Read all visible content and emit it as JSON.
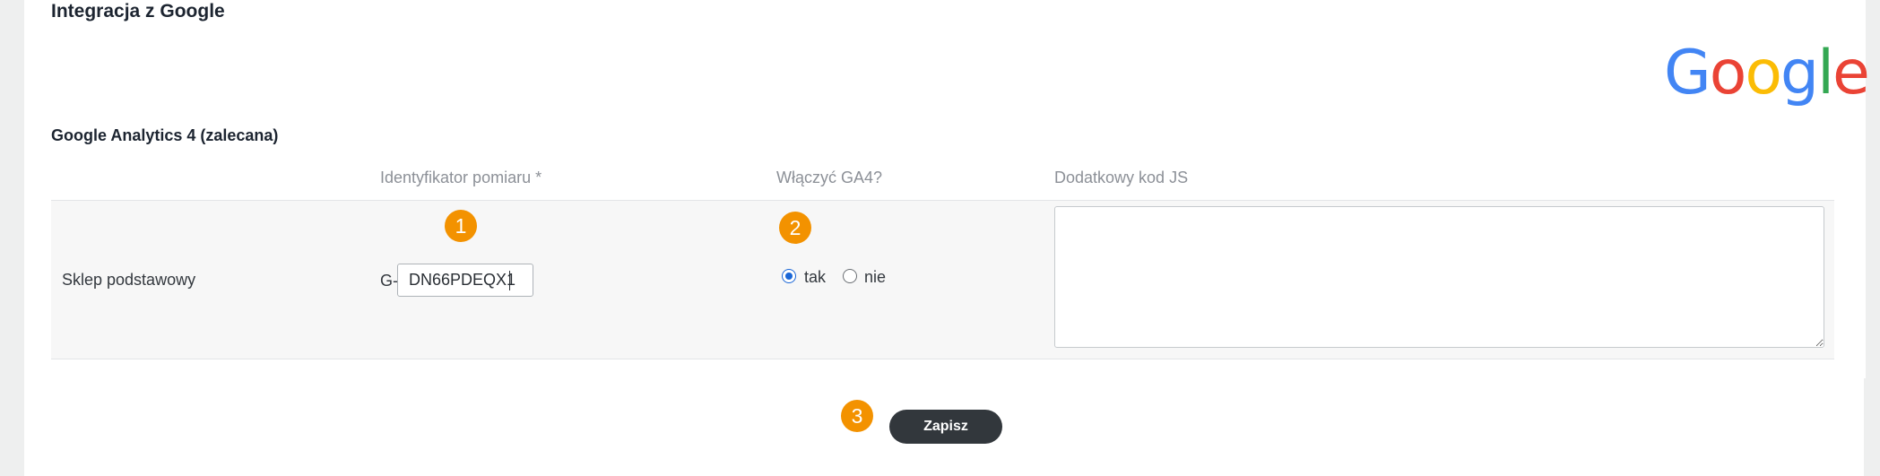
{
  "section": {
    "title": "Integracja z Google"
  },
  "logo": {
    "letters": [
      "G",
      "o",
      "o",
      "g",
      "l",
      "e"
    ]
  },
  "ga4": {
    "title": "Google Analytics 4 (zalecana)",
    "columns": {
      "measurement_id": "Identyfikator pomiaru *",
      "enable_ga4": "Włączyć GA4?",
      "extra_js": "Dodatkowy kod JS"
    },
    "row": {
      "store_name": "Sklep podstawowy",
      "id_prefix": "G-",
      "measurement_id_value": "DN66PDEQX1",
      "enable_options": {
        "yes": "tak",
        "no": "nie",
        "selected": "tak"
      },
      "extra_js_value": ""
    }
  },
  "badges": {
    "step1": "1",
    "step2": "2",
    "step3": "3"
  },
  "actions": {
    "save_label": "Zapisz"
  },
  "colors": {
    "badge": "#f39200",
    "save_button": "#32373c",
    "radio_selected": "#1a66d6"
  }
}
